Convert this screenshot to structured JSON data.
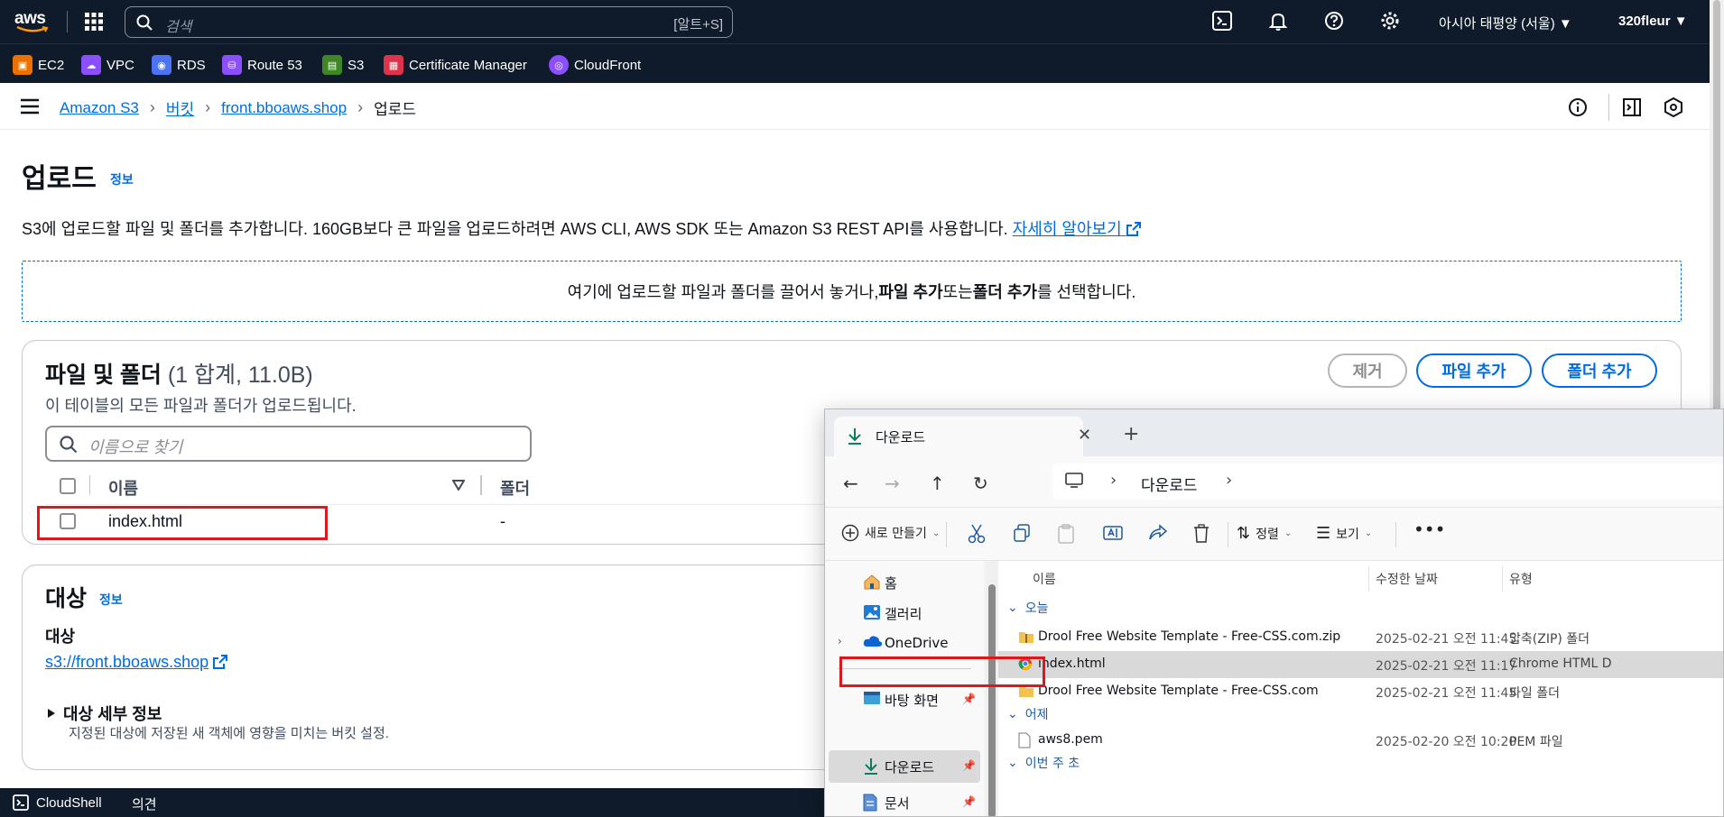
{
  "topnav": {
    "logo_text": "aws",
    "search_placeholder": "검색",
    "search_shortcut": "[알트+S]",
    "region": "아시아 태평양 (서울) ▼",
    "account": "320fleur ▼"
  },
  "favorites": [
    {
      "label": "EC2",
      "color": "#ed7100"
    },
    {
      "label": "VPC",
      "color": "#8c4fff"
    },
    {
      "label": "RDS",
      "color": "#4d72f3"
    },
    {
      "label": "Route 53",
      "color": "#8c4fff"
    },
    {
      "label": "S3",
      "color": "#3f8624"
    },
    {
      "label": "Certificate Manager",
      "color": "#dd344c"
    },
    {
      "label": "CloudFront",
      "color": "#8c4fff"
    }
  ],
  "breadcrumb": {
    "items": [
      "Amazon S3",
      "버킷",
      "front.bboaws.shop"
    ],
    "current": "업로드"
  },
  "page": {
    "title": "업로드",
    "info": "정보",
    "description": "S3에 업로드할 파일 및 폴더를 추가합니다. 160GB보다 큰 파일을 업로드하려면 AWS CLI, AWS SDK 또는 Amazon S3 REST API를 사용합니다.",
    "learn_more": "자세히 알아보기",
    "drop_before": "여기에 업로드할 파일과 폴더를 끌어서 놓거나, ",
    "drop_bold1": "파일 추가",
    "drop_mid": " 또는 ",
    "drop_bold2": "폴더 추가",
    "drop_after": "를 선택합니다."
  },
  "files_panel": {
    "title": "파일 및 폴더",
    "count": "(1 합계, 11.0B)",
    "subtitle": "이 테이블의 모든 파일과 폴더가 업로드됩니다.",
    "remove": "제거",
    "add_file": "파일 추가",
    "add_folder": "폴더 추가",
    "search_placeholder": "이름으로 찾기",
    "col_name": "이름",
    "col_folder": "폴더",
    "row_name": "index.html",
    "row_folder": "-"
  },
  "dest_panel": {
    "title": "대상",
    "info": "정보",
    "label": "대상",
    "link": "s3://front.bboaws.shop",
    "expand": "대상 세부 정보",
    "note": "지정된 대상에 저장된 새 객체에 영향을 미치는 버킷 설정."
  },
  "bottombar": {
    "cloudshell": "CloudShell",
    "feedback": "의견"
  },
  "explorer": {
    "tab_label": "다운로드",
    "address": "다운로드",
    "cmd_new": "새로 만들기",
    "cmd_sort": "정렬",
    "cmd_view": "보기",
    "nav": [
      {
        "label": "홈"
      },
      {
        "label": "갤러리"
      },
      {
        "label": "OneDrive"
      },
      {
        "label": "바탕 화면"
      },
      {
        "label": "다운로드"
      },
      {
        "label": "문서"
      }
    ],
    "col_name": "이름",
    "col_date": "수정한 날짜",
    "col_type": "유형",
    "groups": [
      "오늘",
      "어제",
      "이번 주 초"
    ],
    "files": [
      {
        "name": "Drool Free Website Template - Free-CSS.com.zip",
        "date": "2025-02-21 오전 11:45",
        "type": "압축(ZIP) 폴더"
      },
      {
        "name": "index.html",
        "date": "2025-02-21 오전 11:17",
        "type": "Chrome HTML D"
      },
      {
        "name": "Drool Free Website Template - Free-CSS.com",
        "date": "2025-02-21 오전 11:45",
        "type": "파일 폴더"
      },
      {
        "name": "aws8.pem",
        "date": "2025-02-20 오전 10:20",
        "type": "PEM 파일"
      }
    ]
  }
}
